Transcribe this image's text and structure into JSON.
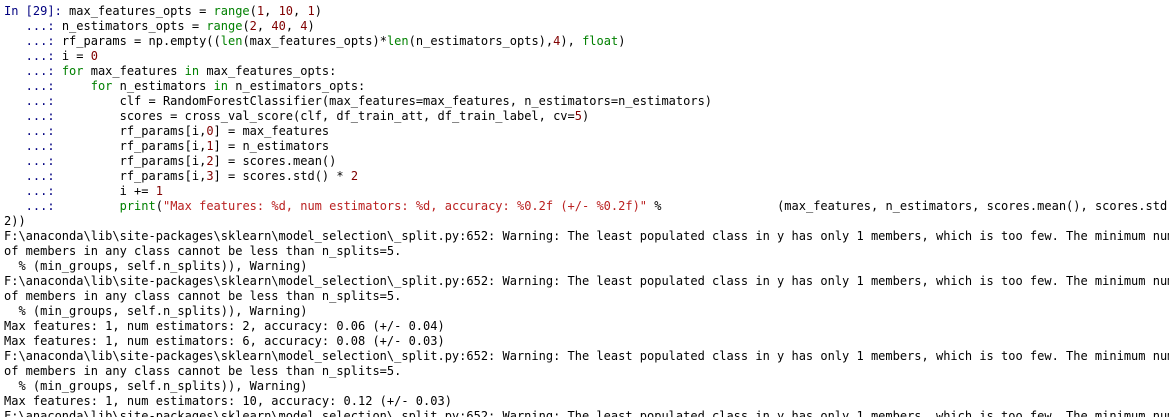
{
  "prompt": {
    "in_label": "In [",
    "number": "29",
    "in_close": "]:",
    "continuation": "...:"
  },
  "code_lines": [
    {
      "prompt": "In [29]:",
      "segments": [
        [
          "plain",
          "max_features_opts = "
        ],
        [
          "bi",
          "range"
        ],
        [
          "plain",
          "("
        ],
        [
          "num",
          "1"
        ],
        [
          "plain",
          ", "
        ],
        [
          "num",
          "10"
        ],
        [
          "plain",
          ", "
        ],
        [
          "num",
          "1"
        ],
        [
          "plain",
          ")"
        ]
      ]
    },
    {
      "prompt": "   ...:",
      "segments": [
        [
          "plain",
          "n_estimators_opts = "
        ],
        [
          "bi",
          "range"
        ],
        [
          "plain",
          "("
        ],
        [
          "num",
          "2"
        ],
        [
          "plain",
          ", "
        ],
        [
          "num",
          "40"
        ],
        [
          "plain",
          ", "
        ],
        [
          "num",
          "4"
        ],
        [
          "plain",
          ")"
        ]
      ]
    },
    {
      "prompt": "   ...:",
      "segments": [
        [
          "plain",
          "rf_params = np.empty(("
        ],
        [
          "bi",
          "len"
        ],
        [
          "plain",
          "(max_features_opts)*"
        ],
        [
          "bi",
          "len"
        ],
        [
          "plain",
          "(n_estimators_opts),"
        ],
        [
          "num",
          "4"
        ],
        [
          "plain",
          "), "
        ],
        [
          "ty",
          "float"
        ],
        [
          "plain",
          ")"
        ]
      ]
    },
    {
      "prompt": "   ...:",
      "segments": [
        [
          "plain",
          "i = "
        ],
        [
          "num",
          "0"
        ]
      ]
    },
    {
      "prompt": "   ...:",
      "segments": [
        [
          "kw",
          "for"
        ],
        [
          "plain",
          " max_features "
        ],
        [
          "kw",
          "in"
        ],
        [
          "plain",
          " max_features_opts:"
        ]
      ]
    },
    {
      "prompt": "   ...:",
      "segments": [
        [
          "plain",
          "    "
        ],
        [
          "kw",
          "for"
        ],
        [
          "plain",
          " n_estimators "
        ],
        [
          "kw",
          "in"
        ],
        [
          "plain",
          " n_estimators_opts:"
        ]
      ]
    },
    {
      "prompt": "   ...:",
      "segments": [
        [
          "plain",
          "        clf = RandomForestClassifier(max_features=max_features, n_estimators=n_estimators)"
        ]
      ]
    },
    {
      "prompt": "   ...:",
      "segments": [
        [
          "plain",
          "        scores = cross_val_score(clf, df_train_att, df_train_label, cv="
        ],
        [
          "num",
          "5"
        ],
        [
          "plain",
          ")"
        ]
      ]
    },
    {
      "prompt": "   ...:",
      "segments": [
        [
          "plain",
          "        rf_params[i,"
        ],
        [
          "num",
          "0"
        ],
        [
          "plain",
          "] = max_features"
        ]
      ]
    },
    {
      "prompt": "   ...:",
      "segments": [
        [
          "plain",
          "        rf_params[i,"
        ],
        [
          "num",
          "1"
        ],
        [
          "plain",
          "] = n_estimators"
        ]
      ]
    },
    {
      "prompt": "   ...:",
      "segments": [
        [
          "plain",
          "        rf_params[i,"
        ],
        [
          "num",
          "2"
        ],
        [
          "plain",
          "] = scores.mean()"
        ]
      ]
    },
    {
      "prompt": "   ...:",
      "segments": [
        [
          "plain",
          "        rf_params[i,"
        ],
        [
          "num",
          "3"
        ],
        [
          "plain",
          "] = scores.std() * "
        ],
        [
          "num",
          "2"
        ]
      ]
    },
    {
      "prompt": "   ...:",
      "segments": [
        [
          "plain",
          "        i += "
        ],
        [
          "num",
          "1"
        ]
      ]
    },
    {
      "prompt": "   ...:",
      "segments": [
        [
          "plain",
          "        "
        ],
        [
          "bi",
          "print"
        ],
        [
          "plain",
          "("
        ],
        [
          "str",
          "\"Max features: %d, num estimators: %d, accuracy: %0.2f (+/- %0.2f)\""
        ],
        [
          "plain",
          " %                (max_features, n_estimators, scores.mean(), scores.std() *"
        ]
      ]
    }
  ],
  "output_lines": [
    "2))",
    "F:\\anaconda\\lib\\site-packages\\sklearn\\model_selection\\_split.py:652: Warning: The least populated class in y has only 1 members, which is too few. The minimum number",
    "of members in any class cannot be less than n_splits=5.",
    "  % (min_groups, self.n_splits)), Warning)",
    "F:\\anaconda\\lib\\site-packages\\sklearn\\model_selection\\_split.py:652: Warning: The least populated class in y has only 1 members, which is too few. The minimum number",
    "of members in any class cannot be less than n_splits=5.",
    "  % (min_groups, self.n_splits)), Warning)",
    "Max features: 1, num estimators: 2, accuracy: 0.06 (+/- 0.04)",
    "Max features: 1, num estimators: 6, accuracy: 0.08 (+/- 0.03)",
    "F:\\anaconda\\lib\\site-packages\\sklearn\\model_selection\\_split.py:652: Warning: The least populated class in y has only 1 members, which is too few. The minimum number",
    "of members in any class cannot be less than n_splits=5.",
    "  % (min_groups, self.n_splits)), Warning)",
    "Max features: 1, num estimators: 10, accuracy: 0.12 (+/- 0.03)",
    "F:\\anaconda\\lib\\site-packages\\sklearn\\model_selection\\_split.py:652: Warning: The least populated class in y has only 1 members, which is too few. The minimum number"
  ],
  "colors": {
    "prompt": "#000080",
    "keyword": "#008000",
    "number": "#800000",
    "string": "#ba2121",
    "background": "#ffffff"
  }
}
